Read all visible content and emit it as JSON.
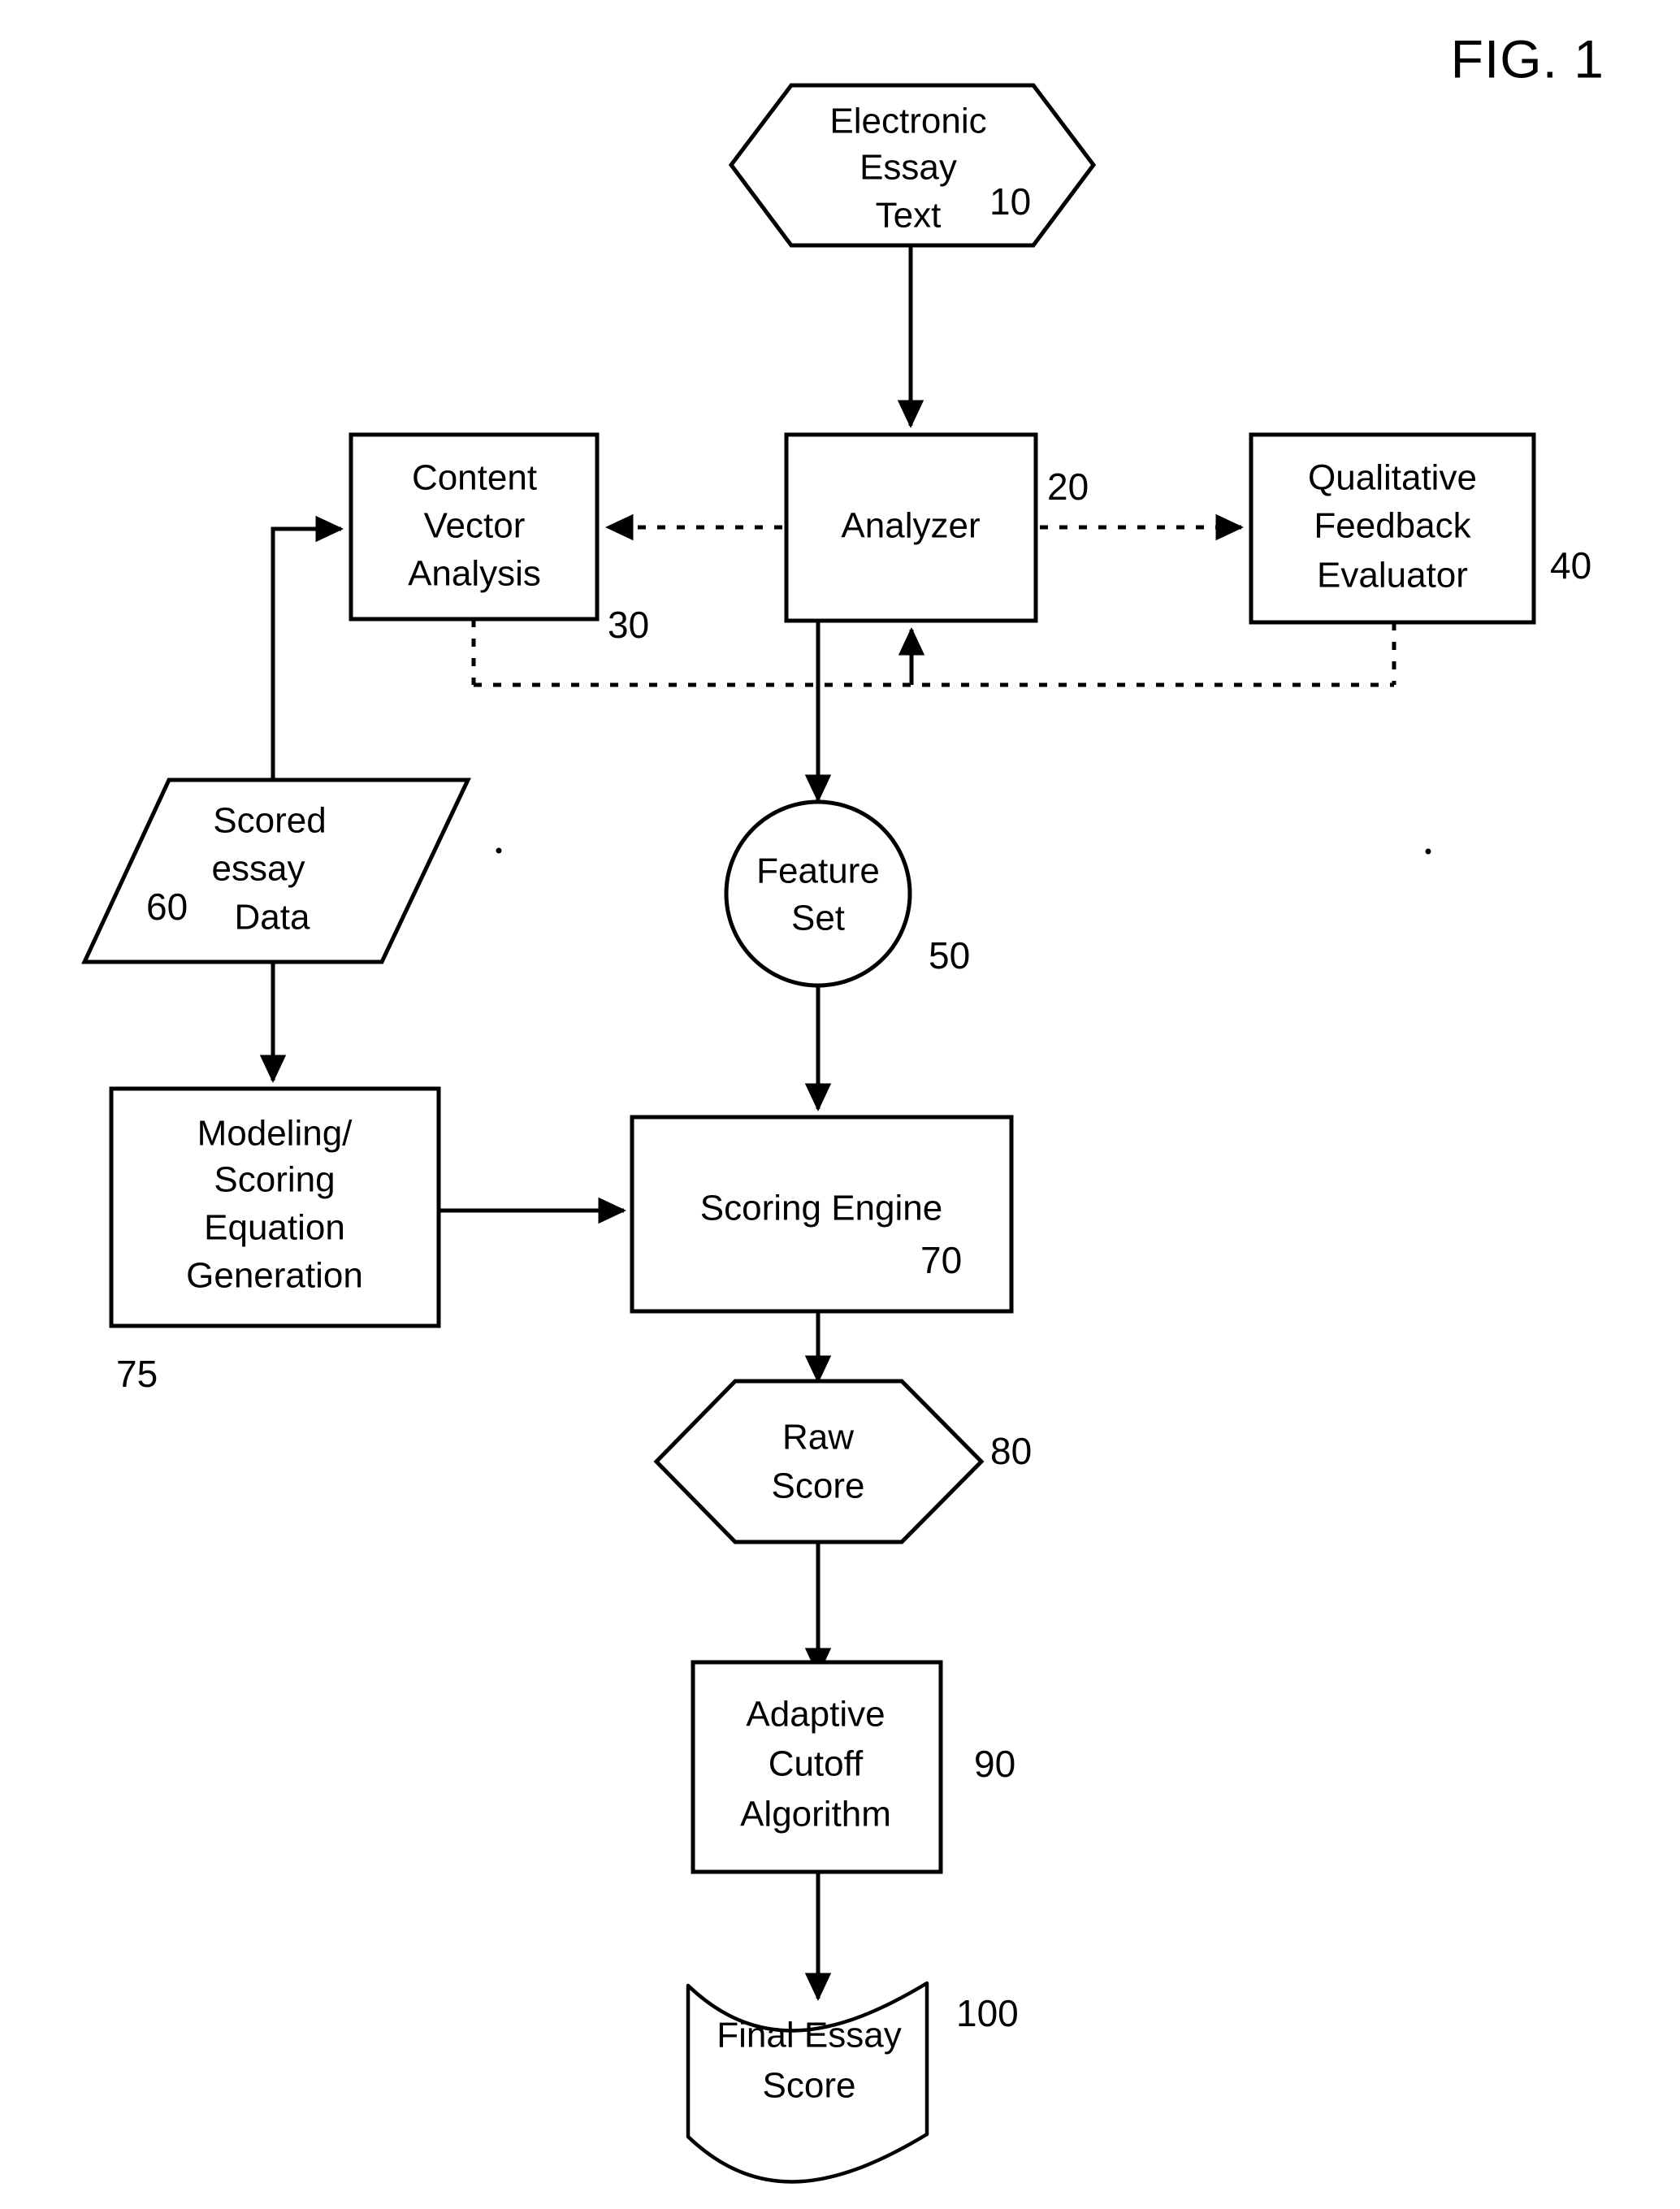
{
  "figure": {
    "title": "FIG. 1"
  },
  "nodes": {
    "electronic_essay_text": {
      "label_lines": [
        "Electronic",
        "Essay",
        "Text"
      ],
      "ref": "10",
      "shape": "hexagon"
    },
    "content_vector_analysis": {
      "label_lines": [
        "Content",
        "Vector",
        "Analysis"
      ],
      "ref": "30",
      "shape": "rectangle"
    },
    "analyzer": {
      "label_lines": [
        "Analyzer"
      ],
      "ref": "20",
      "shape": "rectangle"
    },
    "qualitative_feedback_evaluator": {
      "label_lines": [
        "Qualitative",
        "Feedback",
        "Evaluator"
      ],
      "ref": "40",
      "shape": "rectangle"
    },
    "scored_essay_data": {
      "label_lines": [
        "Scored",
        "essay",
        "Data"
      ],
      "ref": "60",
      "shape": "parallelogram"
    },
    "feature_set": {
      "label_lines": [
        "Feature",
        "Set"
      ],
      "ref": "50",
      "shape": "circle"
    },
    "modeling_scoring_equation_generation": {
      "label_lines": [
        "Modeling/",
        "Scoring",
        "Equation",
        "Generation"
      ],
      "ref": "75",
      "shape": "rectangle"
    },
    "scoring_engine": {
      "label_lines": [
        "Scoring Engine"
      ],
      "ref": "70",
      "shape": "rectangle"
    },
    "raw_score": {
      "label_lines": [
        "Raw",
        "Score"
      ],
      "ref": "80",
      "shape": "hexagon"
    },
    "adaptive_cutoff_algorithm": {
      "label_lines": [
        "Adaptive",
        "Cutoff",
        "Algorithm"
      ],
      "ref": "90",
      "shape": "rectangle"
    },
    "final_essay_score": {
      "label_lines": [
        "Final Essay",
        "Score"
      ],
      "ref": "100",
      "shape": "document"
    }
  },
  "colors": {
    "stroke": "#000000",
    "fill": "#ffffff",
    "background": "#ffffff"
  }
}
